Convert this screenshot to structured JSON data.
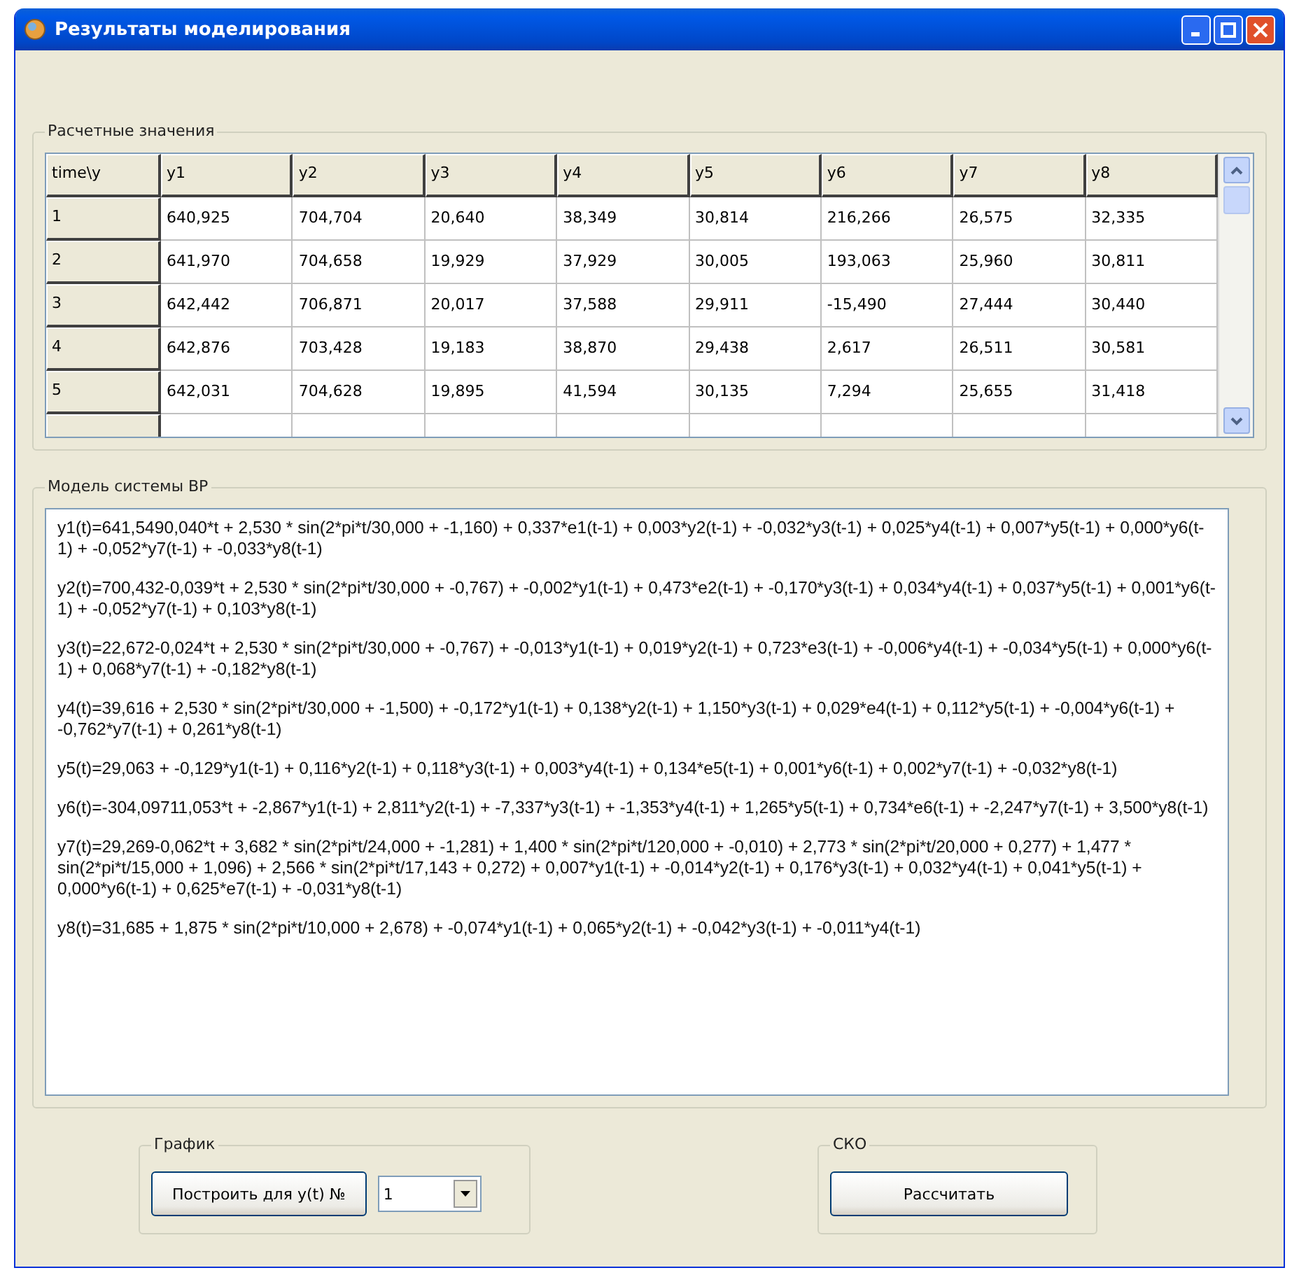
{
  "window": {
    "title": "Результаты моделирования"
  },
  "results_group": {
    "title": "Расчетные значения",
    "table": {
      "columns": [
        "time\\y",
        "y1",
        "y2",
        "y3",
        "y4",
        "y5",
        "y6",
        "y7",
        "y8"
      ],
      "rows": [
        [
          "1",
          "640,925",
          "704,704",
          "20,640",
          "38,349",
          "30,814",
          "216,266",
          "26,575",
          "32,335"
        ],
        [
          "2",
          "641,970",
          "704,658",
          "19,929",
          "37,929",
          "30,005",
          "193,063",
          "25,960",
          "30,811"
        ],
        [
          "3",
          "642,442",
          "706,871",
          "20,017",
          "37,588",
          "29,911",
          "-15,490",
          "27,444",
          "30,440"
        ],
        [
          "4",
          "642,876",
          "703,428",
          "19,183",
          "38,870",
          "29,438",
          "2,617",
          "26,511",
          "30,581"
        ],
        [
          "5",
          "642,031",
          "704,628",
          "19,895",
          "41,594",
          "30,135",
          "7,294",
          "25,655",
          "31,418"
        ]
      ]
    }
  },
  "model_group": {
    "title": "Модель системы ВР",
    "equations": [
      "y1(t)=641,5490,040*t + 2,530 * sin(2*pi*t/30,000 + -1,160) + 0,337*e1(t-1) + 0,003*y2(t-1) + -0,032*y3(t-1) + 0,025*y4(t-1) + 0,007*y5(t-1) + 0,000*y6(t-1) + -0,052*y7(t-1) + -0,033*y8(t-1)",
      "y2(t)=700,432-0,039*t + 2,530 * sin(2*pi*t/30,000 + -0,767) + -0,002*y1(t-1) + 0,473*e2(t-1) + -0,170*y3(t-1) + 0,034*y4(t-1) + 0,037*y5(t-1) + 0,001*y6(t-1) + -0,052*y7(t-1) + 0,103*y8(t-1)",
      "y3(t)=22,672-0,024*t + 2,530 * sin(2*pi*t/30,000 + -0,767) + -0,013*y1(t-1) + 0,019*y2(t-1) + 0,723*e3(t-1) + -0,006*y4(t-1) + -0,034*y5(t-1) + 0,000*y6(t-1) + 0,068*y7(t-1) + -0,182*y8(t-1)",
      "y4(t)=39,616 + 2,530 * sin(2*pi*t/30,000 + -1,500) + -0,172*y1(t-1) + 0,138*y2(t-1) + 1,150*y3(t-1) + 0,029*e4(t-1) + 0,112*y5(t-1) + -0,004*y6(t-1) + -0,762*y7(t-1) + 0,261*y8(t-1)",
      "y5(t)=29,063 + -0,129*y1(t-1) + 0,116*y2(t-1) + 0,118*y3(t-1) + 0,003*y4(t-1) + 0,134*e5(t-1) + 0,001*y6(t-1) + 0,002*y7(t-1) + -0,032*y8(t-1)",
      "y6(t)=-304,09711,053*t + -2,867*y1(t-1) + 2,811*y2(t-1) + -7,337*y3(t-1) + -1,353*y4(t-1) + 1,265*y5(t-1) + 0,734*e6(t-1) + -2,247*y7(t-1) + 3,500*y8(t-1)",
      "y7(t)=29,269-0,062*t + 3,682 * sin(2*pi*t/24,000 + -1,281) + 1,400 * sin(2*pi*t/120,000 + -0,010) + 2,773 * sin(2*pi*t/20,000 + 0,277) + 1,477 * sin(2*pi*t/15,000 + 1,096) + 2,566 * sin(2*pi*t/17,143 + 0,272) + 0,007*y1(t-1) + -0,014*y2(t-1) + 0,176*y3(t-1) + 0,032*y4(t-1) + 0,041*y5(t-1) + 0,000*y6(t-1) + 0,625*e7(t-1) + -0,031*y8(t-1)",
      "y8(t)=31,685 + 1,875 * sin(2*pi*t/10,000 + 2,678) + -0,074*y1(t-1) + 0,065*y2(t-1) + -0,042*y3(t-1) + -0,011*y4(t-1)"
    ]
  },
  "chart_group": {
    "title": "График",
    "button": "Построить для y(t) №",
    "combo_value": "1"
  },
  "rmse_group": {
    "title": "СКО",
    "button": "Рассчитать"
  }
}
